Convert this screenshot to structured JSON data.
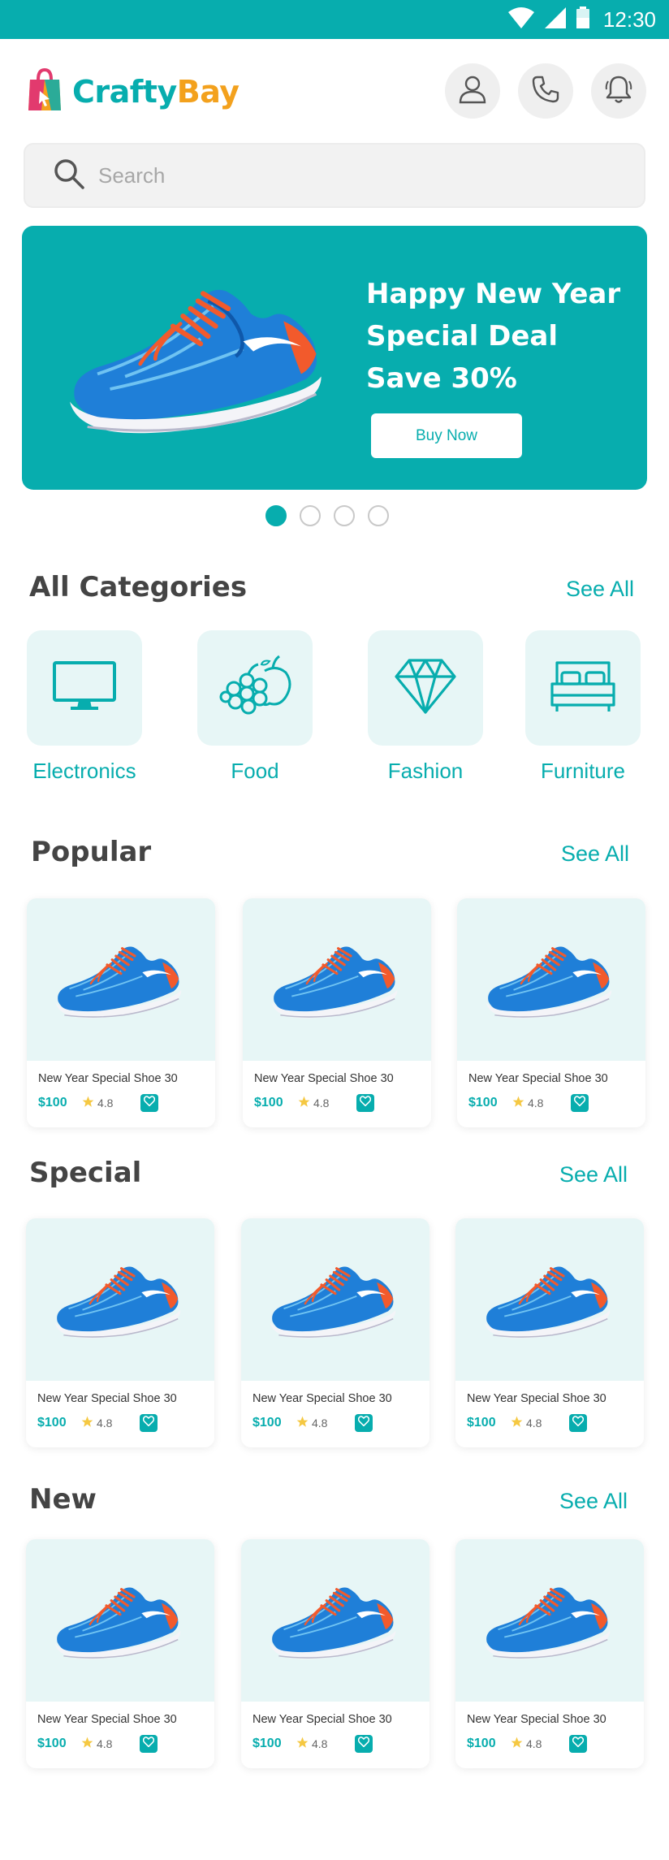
{
  "status_bar": {
    "time": "12:30",
    "bg": "#07adae"
  },
  "header": {
    "brand_part1": "Crafty",
    "brand_part2": "Bay",
    "buttons": [
      "profile-icon",
      "phone-icon",
      "bell-icon"
    ]
  },
  "search": {
    "placeholder": "Search",
    "value": ""
  },
  "banner": {
    "title_line1": "Happy New Year",
    "title_line2": "Special Deal",
    "title_line3": "Save 30%",
    "button_label": "Buy Now",
    "slides": 4,
    "active_slide": 1
  },
  "categories": {
    "title": "All Categories",
    "see_all": "See All",
    "items": [
      {
        "label": "Electronics",
        "icon": "monitor-icon"
      },
      {
        "label": "Food",
        "icon": "fruit-icon"
      },
      {
        "label": "Fashion",
        "icon": "diamond-icon"
      },
      {
        "label": "Furniture",
        "icon": "bed-icon"
      }
    ]
  },
  "product": {
    "name": "New Year Special Shoe 30",
    "price": "$100",
    "rating": "4.8"
  },
  "sections": [
    {
      "title": "Popular",
      "see_all": "See All"
    },
    {
      "title": "Special",
      "see_all": "See All"
    },
    {
      "title": "New",
      "see_all": "See All"
    }
  ],
  "colors": {
    "accent": "#07adae",
    "brand_orange": "#f3a11d",
    "category_bg": "#e7f6f6",
    "star": "#f5c842"
  }
}
